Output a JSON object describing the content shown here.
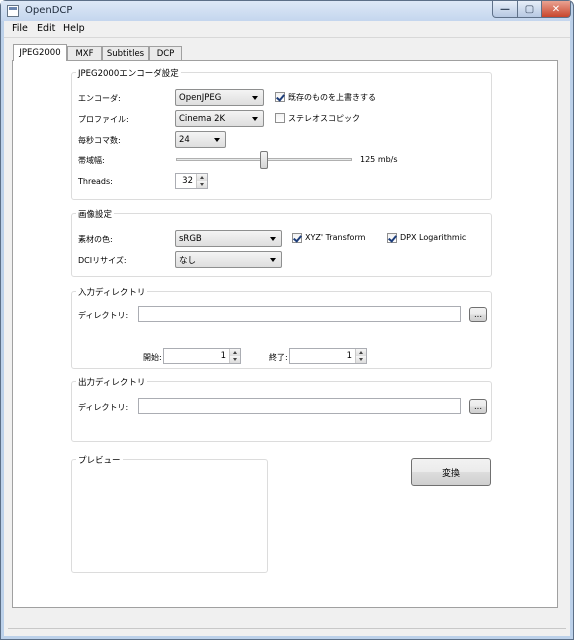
{
  "window": {
    "title": "OpenDCP",
    "min_icon": "minimize-icon",
    "max_icon": "maximize-icon",
    "close_icon": "close-icon",
    "min": "—",
    "max": "▢",
    "close": "✕"
  },
  "menu": [
    "File",
    "Edit",
    "Help"
  ],
  "tabs": [
    "JPEG2000",
    "MXF",
    "Subtitles",
    "DCP"
  ],
  "jpeg2000_group": {
    "title": "JPEG2000エンコーダ設定",
    "encoder_label": "エンコーダ:",
    "encoder_value": "OpenJPEG",
    "overwrite_label": "既存のものを上書きする",
    "overwrite_checked": true,
    "profile_label": "プロファイル:",
    "profile_value": "Cinema 2K",
    "stereo_label": "ステレオスコピック",
    "stereo_checked": false,
    "fps_label": "毎秒コマ数:",
    "fps_value": "24",
    "bandwidth_label": "帯域幅:",
    "bandwidth_value": "125 mb/s",
    "threads_label": "Threads:",
    "threads_value": "32"
  },
  "image_group": {
    "title": "画像設定",
    "color_label": "素材の色:",
    "color_value": "sRGB",
    "xyz_label": "XYZ' Transform",
    "xyz_checked": true,
    "dpx_label": "DPX Logarithmic",
    "dpx_checked": true,
    "resize_label": "DCIリサイズ:",
    "resize_value": "なし"
  },
  "input_group": {
    "title": "入力ディレクトリ",
    "dir_label": "ディレクトリ:",
    "dir_value": "",
    "browse": "...",
    "start_label": "開始:",
    "start_value": "1",
    "end_label": "終了:",
    "end_value": "1"
  },
  "output_group": {
    "title": "出力ディレクトリ",
    "dir_label": "ディレクトリ:",
    "dir_value": "",
    "browse": "..."
  },
  "preview_group": {
    "title": "プレビュー"
  },
  "convert_button": "変換"
}
